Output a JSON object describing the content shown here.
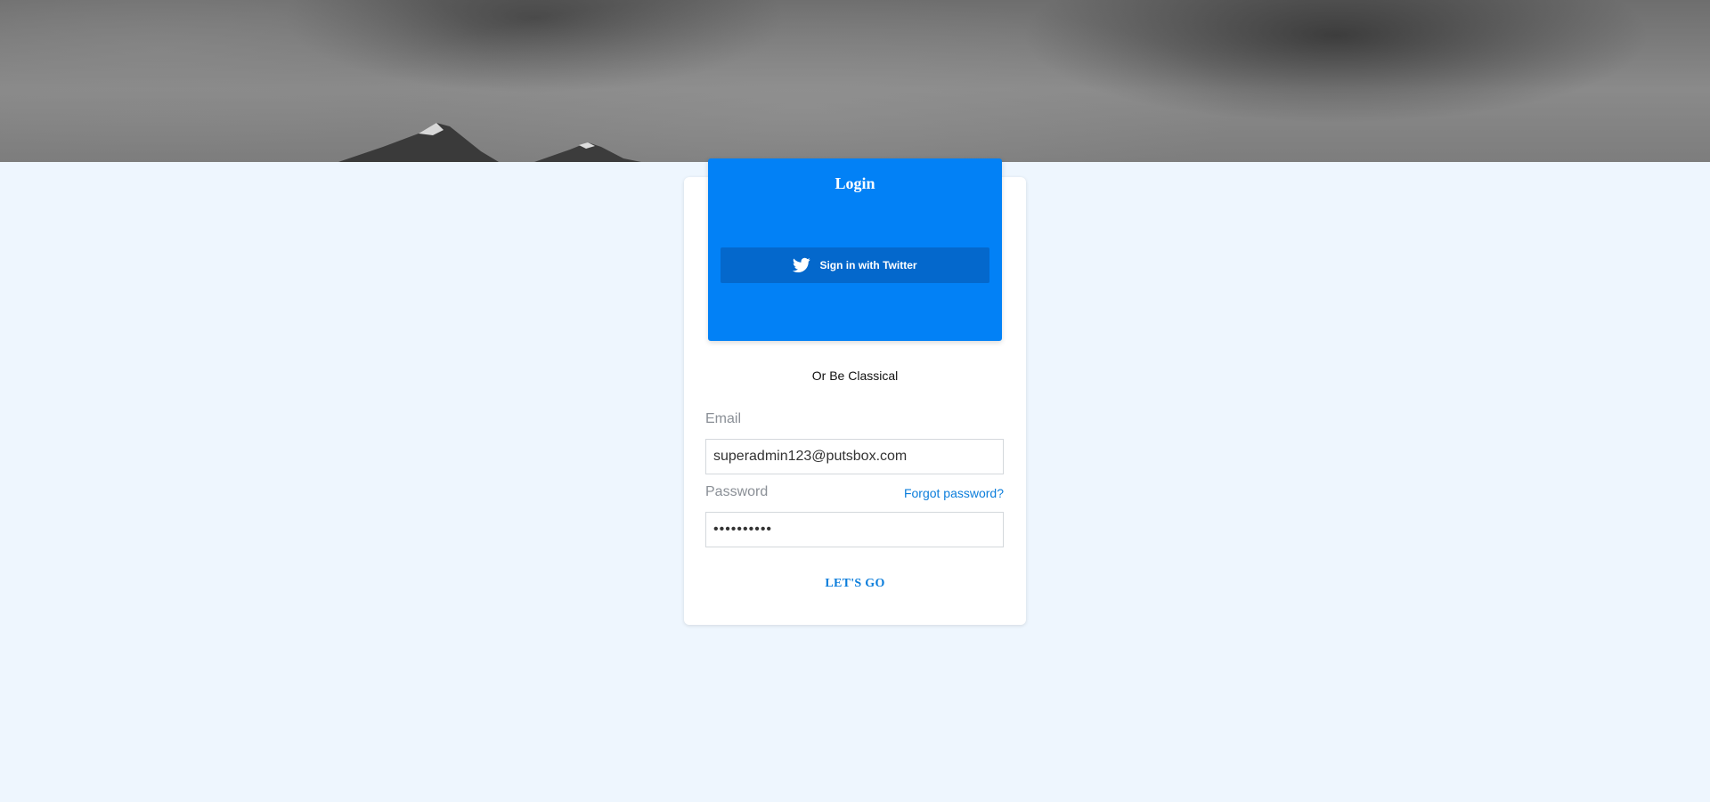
{
  "login": {
    "title": "Login",
    "twitter_button": "Sign in with Twitter",
    "divider_text": "Or Be Classical"
  },
  "form": {
    "email_label": "Email",
    "email_value": "superadmin123@putsbox.com",
    "password_label": "Password",
    "password_value": "••••••••••",
    "forgot_link": "Forgot password?",
    "submit_label": "LET'S GO"
  },
  "colors": {
    "page_background": "#eef6fe",
    "header_blue": "#0281f6",
    "twitter_button": "#0468cc",
    "link_blue": "#0b7ddb"
  },
  "icons": {
    "twitter": "twitter-bird-icon"
  }
}
